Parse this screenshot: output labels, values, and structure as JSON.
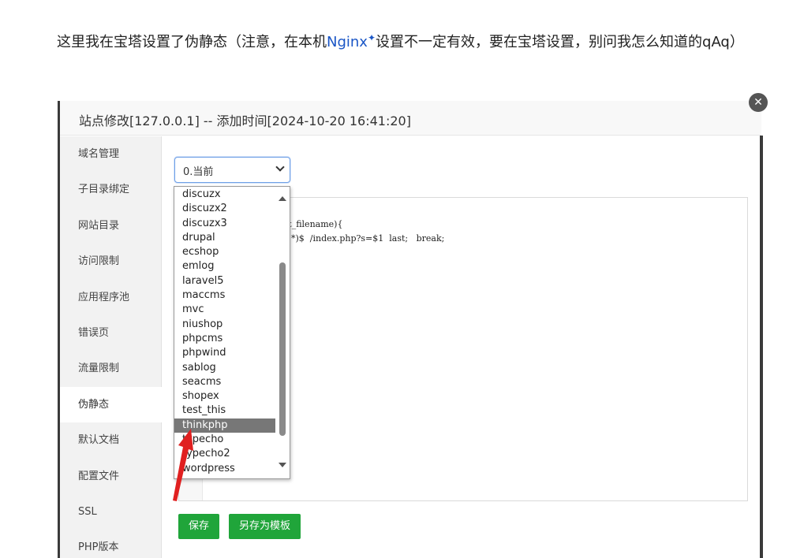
{
  "intro": {
    "line1_a": "这里我在宝塔设置了伪静态（注意，在本机",
    "link": "Nginx",
    "link_mark": "✦",
    "line1_b": "设置不一定有效，要在宝塔设置，别问我怎么知道的qAq）"
  },
  "dialog": {
    "title": "站点修改[127.0.0.1] -- 添加时间[2024-10-20 16:41:20]",
    "close_icon": "✕"
  },
  "sidebar": {
    "items": [
      {
        "label": "域名管理"
      },
      {
        "label": "子目录绑定"
      },
      {
        "label": "网站目录"
      },
      {
        "label": "访问限制"
      },
      {
        "label": "应用程序池"
      },
      {
        "label": "错误页"
      },
      {
        "label": "流量限制"
      },
      {
        "label": "伪静态"
      },
      {
        "label": "默认文档"
      },
      {
        "label": "配置文件"
      },
      {
        "label": "SSL"
      },
      {
        "label": "PHP版本"
      }
    ],
    "active_index": 7
  },
  "rewrite": {
    "selected": "0.当前",
    "options": [
      "discuzx",
      "discuzx2",
      "discuzx3",
      "drupal",
      "ecshop",
      "emlog",
      "laravel5",
      "maccms",
      "mvc",
      "niushop",
      "phpcms",
      "phpwind",
      "sablog",
      "seacms",
      "shopex",
      "test_this",
      "thinkphp",
      "typecho",
      "typecho2",
      "wordpress"
    ],
    "highlighted": "thinkphp"
  },
  "editor": {
    "line1": "quest_filename){",
    "line2": "^(.*)$  /index.php?s=$1  last;   break;"
  },
  "buttons": {
    "save": "保存",
    "save_template": "另存为模板"
  },
  "colors": {
    "accent_green": "#20a53a",
    "highlight_gray": "#777777",
    "annotation_red": "#e02020"
  }
}
